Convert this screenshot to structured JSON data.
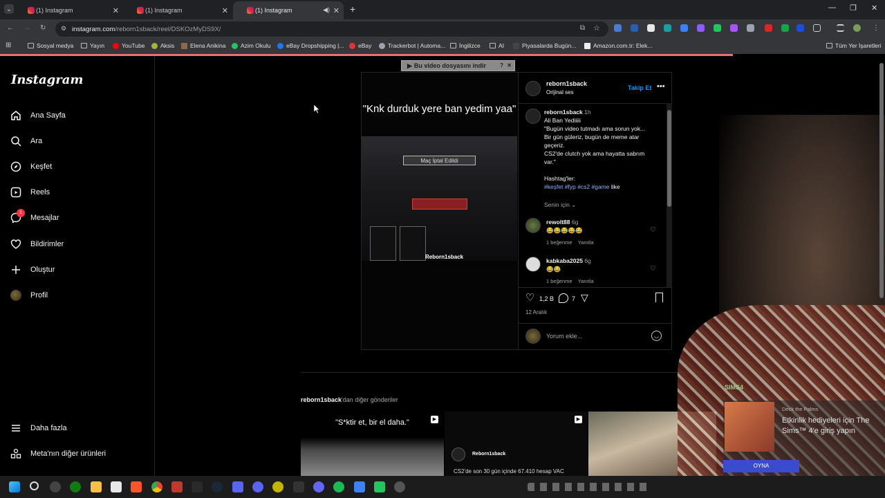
{
  "browser": {
    "tabs": [
      {
        "title": "(1) Instagram"
      },
      {
        "title": "(1) Instagram"
      },
      {
        "title": "(1) Instagram"
      }
    ],
    "url_host": "instagram.com",
    "url_path": "/reborn1sback/reel/DSKOzMyDS9X/",
    "bookmarks": [
      "Sosyal medya",
      "Yayın",
      "YouTube",
      "Aksis",
      "Elena Anikina",
      "Azim Okulu",
      "eBay Dropshipping |...",
      "eBay",
      "Trackerbot | Automa...",
      "İngilizce",
      "AI",
      "Piyasalarda Bugün...",
      "Amazon.com.tr: Elek...",
      "Tüm Yer İşaretleri"
    ]
  },
  "download_bar": "Bu video dosyasını indir",
  "sidebar": {
    "logo": "Instagram",
    "items": [
      {
        "label": "Ana Sayfa",
        "icon": "home-icon"
      },
      {
        "label": "Ara",
        "icon": "search-icon"
      },
      {
        "label": "Keşfet",
        "icon": "compass-icon"
      },
      {
        "label": "Reels",
        "icon": "reels-icon"
      },
      {
        "label": "Mesajlar",
        "icon": "messenger-icon",
        "badge": "1"
      },
      {
        "label": "Bildirimler",
        "icon": "heart-icon"
      },
      {
        "label": "Oluştur",
        "icon": "plus-icon"
      },
      {
        "label": "Profil",
        "icon": "avatar-icon"
      }
    ],
    "more": "Daha fazla",
    "meta": "Meta'nın diğer ürünleri"
  },
  "post": {
    "video_caption": "\"Knk durduk yere ban yedim yaa\"",
    "video_banner": "Maç İptal Edildi",
    "video_watermark": "Reborn1sback",
    "author": "reborn1sback",
    "audio": "Orijinal ses",
    "follow": "Takip Et",
    "caption_author": "reborn1sback",
    "caption_time": "1h",
    "caption_lines": [
      "Ali Ban Yediiiii",
      "\"Bugün video tutmadı ama sorun yok...",
      "Bir gün güleriz, bugün de meme atar",
      "geçeriz.",
      "CS2'de clutch yok ama hayatta sabrım",
      "var.\""
    ],
    "hashtag_title": "Hashtag'ler:",
    "hashtags": "#keşfet #fyp #cs2 #game",
    "hashtag_suffix": "like",
    "for_you": "Senin için",
    "comments": [
      {
        "user": "rewolt88",
        "time": "6g",
        "text": "😂😂😂😂😂",
        "likes": "1 beğenme",
        "reply": "Yanıtla"
      },
      {
        "user": "kabkaba2025",
        "time": "6g",
        "text": "😂😂",
        "likes": "1 beğenme",
        "reply": "Yanıtla"
      }
    ],
    "like_count": "1,2 B",
    "comment_count": "7",
    "date": "12 Aralık",
    "comment_placeholder": "Yorum ekle..."
  },
  "more_posts": {
    "title_user": "reborn1sback",
    "title_rest": "'dan diğer gönderiler",
    "thumb1_text": "\"S*ktir et, bir el daha.\"",
    "thumb2_user": "Reborn1sback",
    "thumb2_text": "CS2'de son 30 gün içinde 67.410 hesap VAC"
  },
  "overlay": {
    "game_label": "SIMS4",
    "notif_title": "Deck the Palms",
    "notif_text": "Etkinlik hediyeleri için The Sims™ 4'e giriş yapın",
    "play": "OYNA"
  }
}
